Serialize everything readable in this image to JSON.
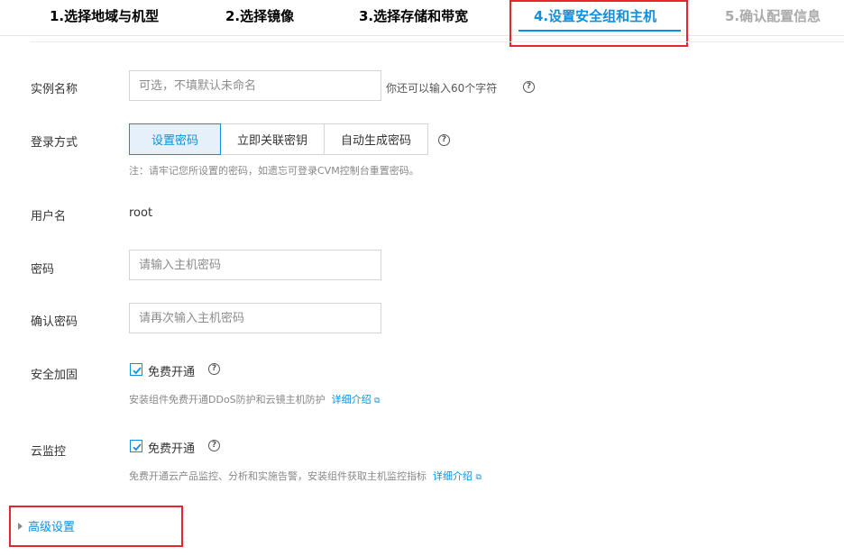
{
  "steps": [
    {
      "label": "1.选择地域与机型"
    },
    {
      "label": "2.选择镜像"
    },
    {
      "label": "3.选择存储和带宽"
    },
    {
      "label": "4.设置安全组和主机"
    },
    {
      "label": "5.确认配置信息"
    }
  ],
  "colors": {
    "accent": "#0d8fe0",
    "highlight_box": "#e4262e",
    "disabled_step": "#aaaaaa"
  },
  "form": {
    "instance_name": {
      "label": "实例名称",
      "placeholder": "可选，不填默认未命名",
      "hint": "你还可以输入60个字符"
    },
    "login": {
      "label": "登录方式",
      "options": [
        "设置密码",
        "立即关联密钥",
        "自动生成密码"
      ],
      "selected": "设置密码",
      "note": "注：请牢记您所设置的密码，如遗忘可登录CVM控制台重置密码。"
    },
    "username": {
      "label": "用户名",
      "value": "root"
    },
    "password": {
      "label": "密码",
      "placeholder": "请输入主机密码"
    },
    "confirm_password": {
      "label": "确认密码",
      "placeholder": "请再次输入主机密码"
    },
    "security": {
      "label": "安全加固",
      "checkbox_label": "免费开通",
      "checked": true,
      "desc": "安装组件免费开通DDoS防护和云镜主机防护",
      "link": "详细介绍"
    },
    "monitor": {
      "label": "云监控",
      "checkbox_label": "免费开通",
      "checked": true,
      "desc": "免费开通云产品监控、分析和实施告警，安装组件获取主机监控指标",
      "link": "详细介绍"
    }
  },
  "advanced": {
    "label": "高级设置"
  }
}
